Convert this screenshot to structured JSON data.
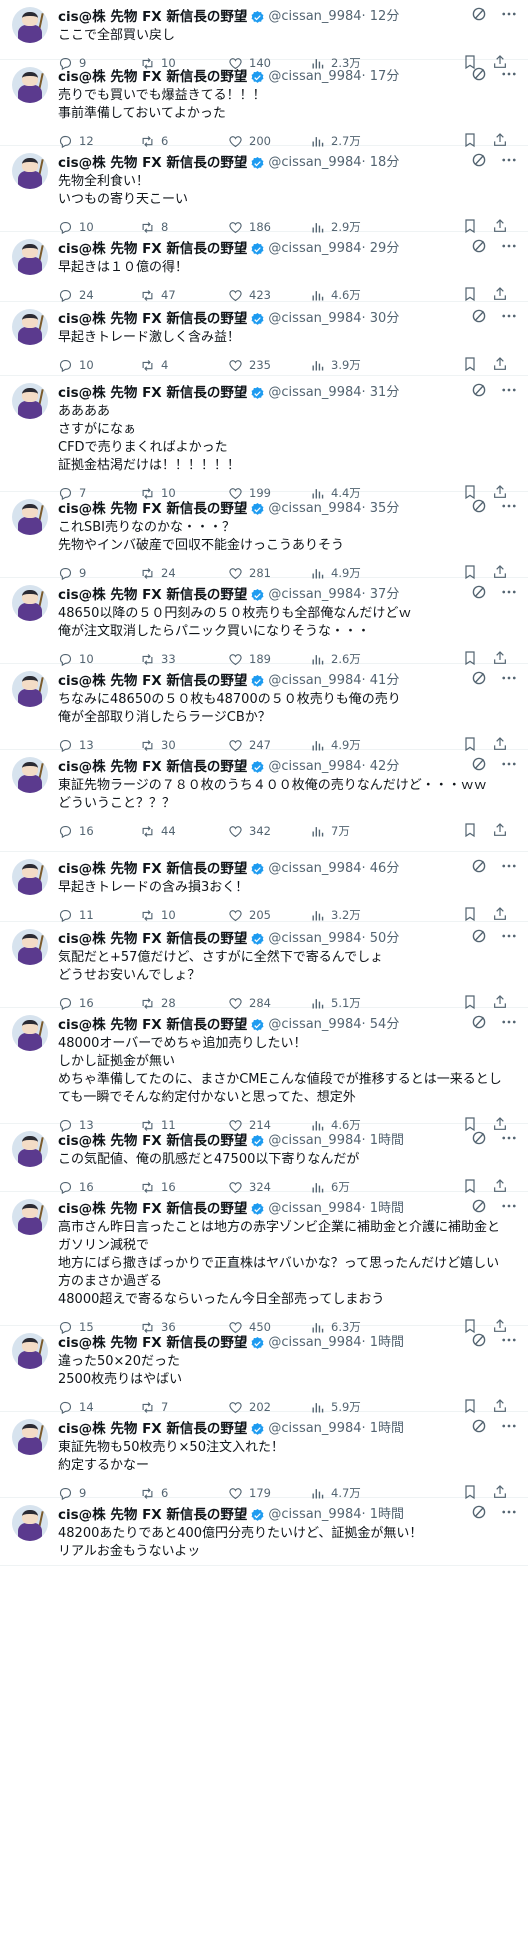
{
  "author": {
    "name": "cis@株 先物 FX 新信長の野望",
    "handle": "@cissan_9984"
  },
  "colors": {
    "verified": "#1d9bf0",
    "muted": "#536471",
    "text": "#0f1419"
  },
  "tweets": [
    {
      "time": "· 12分",
      "text": "ここで全部買い戻し",
      "reply": "9",
      "rt": "10",
      "like": "140",
      "views": "2.3万",
      "h": 60
    },
    {
      "time": "· 17分",
      "text": "売りでも買いでも爆益きてる！！！\n事前準備しておいてよかった",
      "reply": "12",
      "rt": "6",
      "like": "200",
      "views": "2.7万",
      "h": 86
    },
    {
      "time": "· 18分",
      "text": "先物全利食い！\nいつもの寄り天こーい",
      "reply": "10",
      "rt": "8",
      "like": "186",
      "views": "2.9万",
      "h": 86
    },
    {
      "time": "· 29分",
      "text": "早起きは１０億の得！",
      "reply": "24",
      "rt": "47",
      "like": "423",
      "views": "4.6万",
      "h": 70
    },
    {
      "time": "· 30分",
      "text": "早起きトレード激しく含み益！",
      "reply": "10",
      "rt": "4",
      "like": "235",
      "views": "3.9万",
      "h": 74
    },
    {
      "time": "· 31分",
      "text": "ああああ\nさすがになぁ\nCFDで売りまくればよかった\n証拠金枯渇だけは！！！！！！",
      "reply": "7",
      "rt": "10",
      "like": "199",
      "views": "4.4万",
      "h": 116
    },
    {
      "time": "· 35分",
      "text": "これSBI売りなのかな・・・？\n先物やインバ破産で回収不能金けっこうありそう",
      "reply": "9",
      "rt": "24",
      "like": "281",
      "views": "4.9万",
      "h": 86
    },
    {
      "time": "· 37分",
      "text": "48650以降の５０円刻みの５０枚売りも全部俺なんだけどｗ\n俺が注文取消したらパニック買いになりそうな・・・",
      "reply": "10",
      "rt": "33",
      "like": "189",
      "views": "2.6万",
      "h": 86
    },
    {
      "time": "· 41分",
      "text": "ちなみに48650の５０枚も48700の５０枚売りも俺の売り\n俺が全部取り消したらラージCBか？",
      "reply": "13",
      "rt": "30",
      "like": "247",
      "views": "4.9万",
      "h": 86
    },
    {
      "time": "· 42分",
      "text": "東証先物ラージの７８０枚のうち４００枚俺の売りなんだけど・・・ｗｗ\nどういうこと？？？",
      "reply": "16",
      "rt": "44",
      "like": "342",
      "views": "7万",
      "h": 102
    },
    {
      "time": "· 46分",
      "text": "早起きトレードの含み損3おく！",
      "reply": "11",
      "rt": "10",
      "like": "205",
      "views": "3.2万",
      "h": 70
    },
    {
      "time": "· 50分",
      "text": "気配だと+57億だけど、さすがに全然下で寄るんでしょ\nどうせお安いんでしょ？",
      "reply": "16",
      "rt": "28",
      "like": "284",
      "views": "5.1万",
      "h": 86
    },
    {
      "time": "· 54分",
      "text": "48000オーバーでめちゃ追加売りしたい！\nしかし証拠金が無い\nめちゃ準備してたのに、まさかCMEこんな値段でが推移するとは一来るとしても一瞬でそんな約定付かないと思ってた、想定外",
      "reply": "13",
      "rt": "11",
      "like": "214",
      "views": "4.6万",
      "h": 116
    },
    {
      "time": "· 1時間",
      "text": "この気配値、俺の肌感だと47500以下寄りなんだが",
      "reply": "16",
      "rt": "16",
      "like": "324",
      "views": "6万",
      "h": 68
    },
    {
      "time": "· 1時間",
      "text": "高市さん昨日言ったことは地方の赤字ゾンビ企業に補助金と介護に補助金とガソリン減税で\n地方にばら撒きばっかりで正直株はヤバいかな？って思ったんだけど嬉しい方のまさか過ぎる\n48000超えで寄るならいったん今日全部売ってしまおう",
      "reply": "15",
      "rt": "36",
      "like": "450",
      "views": "6.3万",
      "h": 134
    },
    {
      "time": "· 1時間",
      "text": "違った50×20だった\n2500枚売りはやばい",
      "reply": "14",
      "rt": "7",
      "like": "202",
      "views": "5.9万",
      "h": 86
    },
    {
      "time": "· 1時間",
      "text": "東証先物も50枚売り×50注文入れた！\n約定するかなー",
      "reply": "9",
      "rt": "6",
      "like": "179",
      "views": "4.7万",
      "h": 86
    },
    {
      "time": "· 1時間",
      "text": "48200あたりであと400億円分売りたいけど、証拠金が無い！\nリアルお金もうないよッ",
      "reply": "",
      "rt": "",
      "like": "",
      "views": "",
      "h": 68
    }
  ]
}
